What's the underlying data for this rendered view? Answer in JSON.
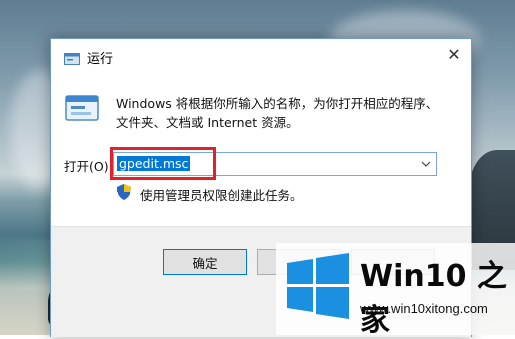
{
  "dialog": {
    "title": "运行",
    "description_line1": "Windows 将根据你所输入的名称，为你打开相应的程序、",
    "description_line2": "文件夹、文档或 Internet 资源。",
    "open_label": "打开(O):",
    "input_value": "gpedit.msc",
    "admin_note": "使用管理员权限创建此任务。",
    "close_glyph": "✕",
    "buttons": {
      "ok": "确定",
      "cancel": "",
      "browse": ""
    }
  },
  "watermark": {
    "title": "Win10 之家",
    "url": "www.win10xitong.com"
  },
  "colors": {
    "accent": "#0078d7",
    "highlight_box": "#e0232a",
    "dialog_border": "#6f9bc8"
  },
  "icons": [
    "run-title-icon",
    "run-app-icon",
    "shield-icon",
    "chevron-down-icon",
    "close-icon",
    "windows-logo-icon"
  ]
}
